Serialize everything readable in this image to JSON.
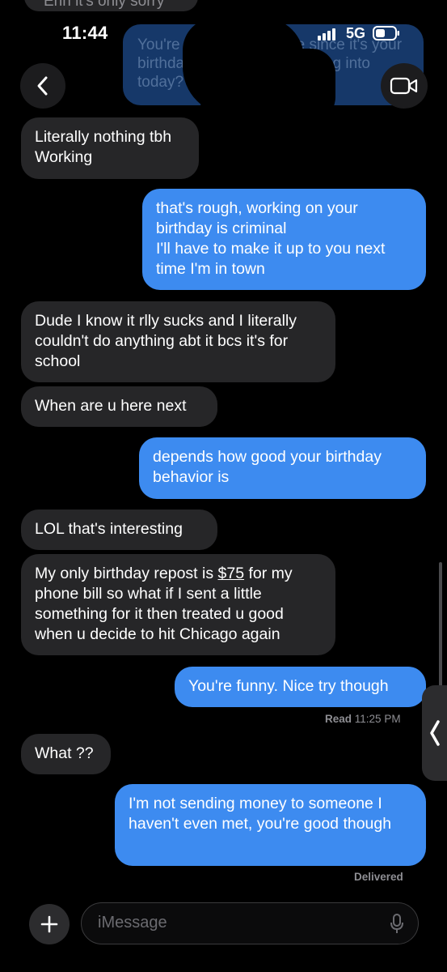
{
  "status_bar": {
    "time": "11:44",
    "network": "5G",
    "signal_icon": "signal-bars-icon",
    "battery_icon": "battery-icon"
  },
  "header": {
    "back_icon": "chevron-left-icon",
    "video_icon": "video-camera-icon"
  },
  "background_messages": {
    "top_fragment": "Ehh it's only sorry",
    "ghost_bubble": "You're good I'll let it slide since it's your birthday. What are you getting into today?"
  },
  "messages": [
    {
      "direction": "received",
      "text": "Literally nothing tbh\nWorking"
    },
    {
      "direction": "sent",
      "text": "that's rough, working on your birthday is criminal\nI'll have to make it up to you next time I'm in town"
    },
    {
      "direction": "received",
      "text": "Dude I know it rlly sucks and I literally couldn't do anything abt it bcs it's for school"
    },
    {
      "direction": "received",
      "text": "When are u here next"
    },
    {
      "direction": "sent",
      "text": "depends how good your birthday behavior is"
    },
    {
      "direction": "received",
      "text": "LOL that's interesting"
    },
    {
      "direction": "received",
      "text_before": "My only birthday repost is ",
      "link": "$75",
      "text_after": " for my phone bill so what if I sent a little something for it then treated u good when u decide to hit Chicago again"
    },
    {
      "direction": "sent",
      "text": "You're funny. Nice try though"
    },
    {
      "direction": "received",
      "text": "What ??"
    },
    {
      "direction": "sent",
      "text": "I'm not sending money to someone I haven't even met, you're good though"
    }
  ],
  "read_receipt": {
    "label": "Read",
    "time": "11:25 PM"
  },
  "delivered_receipt": "Delivered",
  "composer": {
    "placeholder": "iMessage",
    "plus_icon": "plus-icon",
    "mic_icon": "microphone-icon"
  },
  "side_handle_icon": "chevron-left-icon",
  "colors": {
    "sent_bubble": "#3d8bf0",
    "received_bubble": "#262628",
    "background": "#000000"
  }
}
